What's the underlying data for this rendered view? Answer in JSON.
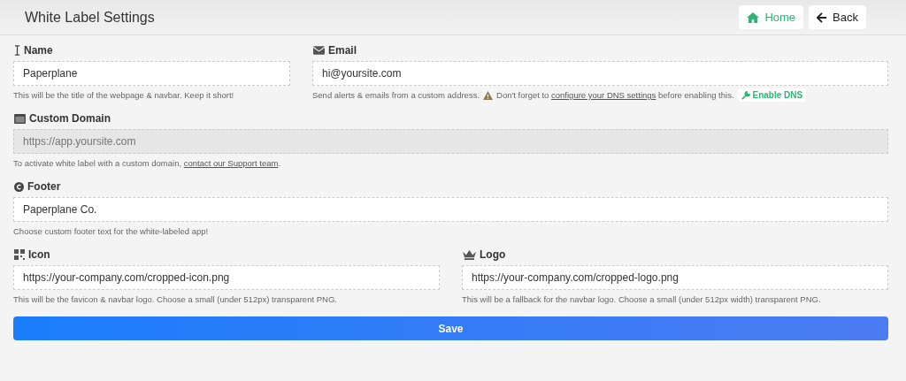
{
  "header": {
    "title": "White Label Settings",
    "buttons": [
      {
        "label": "Home",
        "accent": true
      },
      {
        "label": "Back",
        "accent": false
      }
    ]
  },
  "rows": [
    {
      "fields": [
        {
          "label": "Name",
          "value": "Paperplane",
          "disabled": false,
          "hint": [
            {
              "kind": "text",
              "text": "This will be the title of the webpage & navbar. Keep it short!"
            }
          ]
        },
        {
          "label": "Email",
          "value": "hi@yoursite.com",
          "disabled": false,
          "hint": [
            {
              "kind": "text",
              "text": "Send alerts & emails from a custom address."
            },
            {
              "kind": "warning"
            },
            {
              "kind": "text",
              "text": "Don't forget to",
              "link": "configure your DNS settings",
              "after": "before enabling this."
            },
            {
              "kind": "button",
              "text": "Enable DNS"
            }
          ]
        }
      ]
    },
    {
      "fields": [
        {
          "label": "Custom Domain",
          "placeholder": "https://app.yoursite.com",
          "disabled": true,
          "hint": [
            {
              "kind": "text",
              "text": "To activate white label with a custom domain,",
              "link": "contact our Support team",
              "after": "."
            }
          ]
        }
      ]
    },
    {
      "fields": [
        {
          "label": "Footer",
          "value": "Paperplane Co.",
          "disabled": false,
          "hint": [
            {
              "kind": "text",
              "text": "Choose custom footer text for the white-labeled app!"
            }
          ]
        }
      ]
    },
    {
      "fields": [
        {
          "label": "Icon",
          "value": "https://your-company.com/cropped-icon.png",
          "disabled": false,
          "hint": [
            {
              "kind": "text",
              "text": "This will be the favicon & navbar logo. Choose a small (under 512px) transparent PNG."
            }
          ]
        },
        {
          "label": "Logo",
          "value": "https://your-company.com/cropped-logo.png",
          "disabled": false,
          "hint": [
            {
              "kind": "text",
              "text": "This will be a fallback for the navbar logo. Choose a small (under 512px width) transparent PNG."
            }
          ]
        }
      ]
    }
  ],
  "save_button": "Save"
}
